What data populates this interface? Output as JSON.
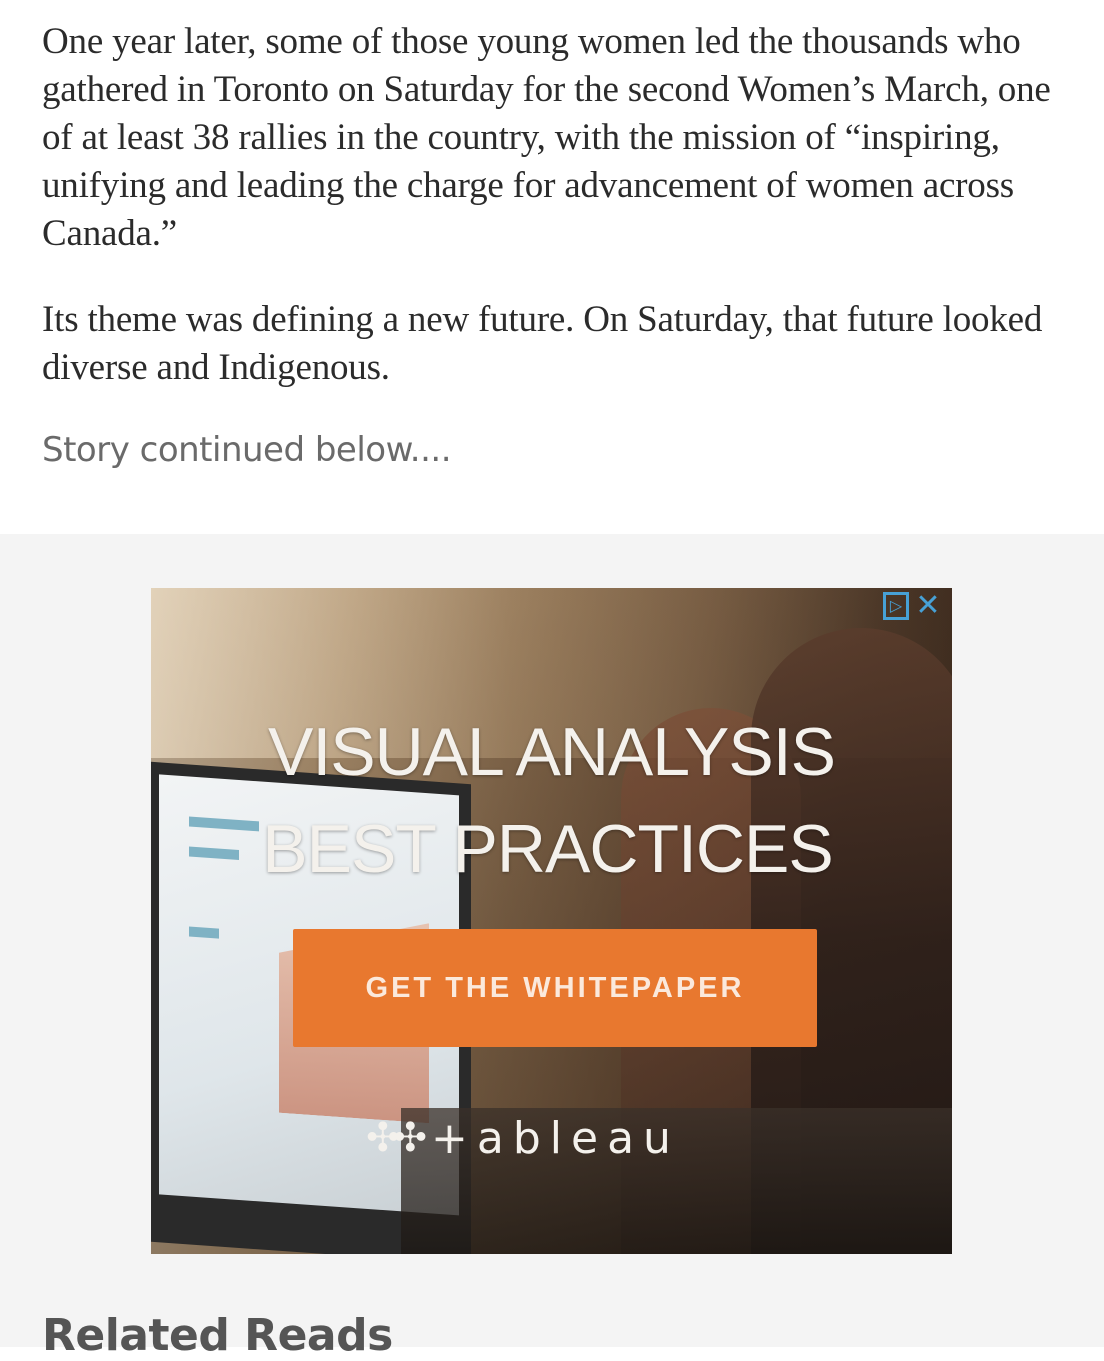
{
  "article": {
    "paragraph_1": "One year later, some of those young women led the thousands who gathered in Toronto on Saturday for the second Women’s March, one of at least 38 rallies in the country, with the mission of “inspiring, unifying and leading the charge for advancement of women across Canada.”",
    "paragraph_2": "Its theme was defining a new future. On Saturday, that future looked diverse and Indigenous.",
    "continued_note": "Story continued below...."
  },
  "ad": {
    "headline_line_1": "VISUAL ANALYSIS",
    "headline_line_2": "BEST PRACTICES",
    "cta_label": "GET THE WHITEPAPER",
    "brand_name": "+ableau",
    "brand_mark_icon": "tableau-logo-icon",
    "adchoices_icon": "adchoices-icon",
    "close_icon": "close-icon",
    "cta_color": "#e8782f",
    "adchoices_color": "#47a1d6"
  },
  "related": {
    "heading": "Related Reads"
  }
}
